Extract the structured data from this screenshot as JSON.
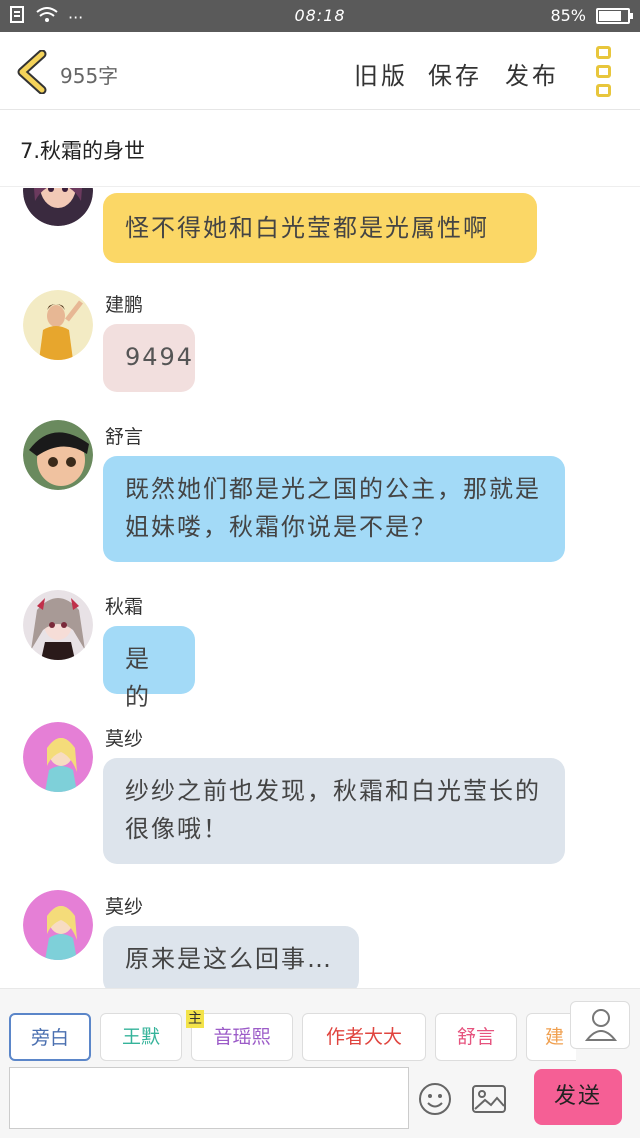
{
  "status_bar": {
    "time": "08:18",
    "battery_percent": "85%",
    "battery_level": 0.85,
    "dots": "···"
  },
  "header": {
    "word_count": "955字",
    "old_version": "旧版",
    "save": "保存",
    "publish": "发布"
  },
  "title": "7.秋霜的身世",
  "messages": [
    {
      "name": "",
      "text": "怪不得她和白光莹都是光属性啊",
      "color": "yellow"
    },
    {
      "name": "建鹏",
      "text": "9494",
      "color": "pink"
    },
    {
      "name": "舒言",
      "text": "既然她们都是光之国的公主，那就是姐妹喽，秋霜你说是不是？",
      "color": "blue"
    },
    {
      "name": "秋霜",
      "text": "是的",
      "color": "blue"
    },
    {
      "name": "莫纱",
      "text": "纱纱之前也发现，秋霜和白光莹长的很像哦！",
      "color": "grey"
    },
    {
      "name": "莫纱",
      "text": "原来是这么回事…",
      "color": "grey"
    }
  ],
  "roles": [
    {
      "label": "旁白",
      "color": "#4a6fb0"
    },
    {
      "label": "王默",
      "color": "#35b39a"
    },
    {
      "label": "音瑶熙",
      "color": "#9c5cc8",
      "tag": "主"
    },
    {
      "label": "作者大大",
      "color": "#e0453f"
    },
    {
      "label": "舒言",
      "color": "#e6537e"
    },
    {
      "label": "建",
      "color": "#f0a050"
    }
  ],
  "send_label": "发送"
}
